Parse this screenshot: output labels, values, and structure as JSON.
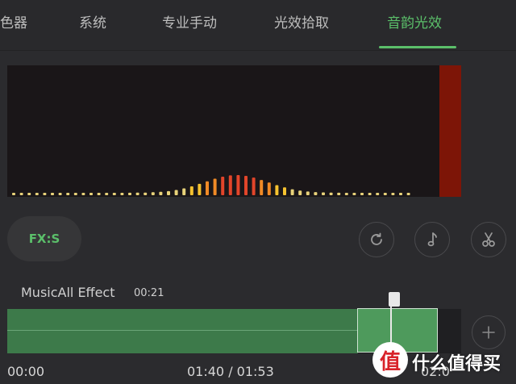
{
  "tabs": [
    {
      "label": "色器",
      "active": false
    },
    {
      "label": "系统",
      "active": false
    },
    {
      "label": "专业手动",
      "active": false
    },
    {
      "label": "光效拾取",
      "active": false
    },
    {
      "label": "音韵光效",
      "active": true
    }
  ],
  "colors": {
    "accent": "#5bbf6a",
    "background": "#2b2b2e",
    "spectrum_bg": "#1a1618",
    "color_block": "#7d1507",
    "track": "#3d7a4a"
  },
  "effect_button": {
    "label": "FX:S"
  },
  "icons": {
    "refresh": "refresh-icon",
    "music": "music-note-icon",
    "scissors": "scissors-icon",
    "add": "plus-icon"
  },
  "clip": {
    "name": "MusicAll Effect",
    "duration": "00:21"
  },
  "timeline": {
    "start": "00:00",
    "current_total": "01:40 / 01:53",
    "end": "02:0"
  },
  "watermark": {
    "logo_char": "值",
    "text": "什么值得买"
  }
}
